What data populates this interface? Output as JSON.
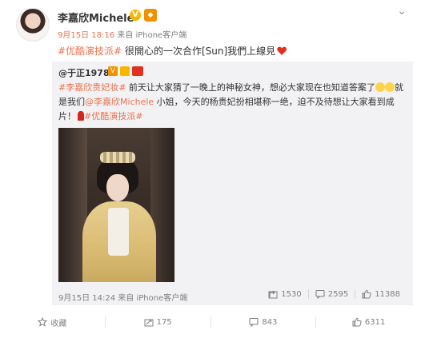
{
  "header": {
    "author": "李嘉欣Michele",
    "v_badge": "V",
    "time": "9月15日 18:16",
    "source": "来自 iPhone客户端"
  },
  "post": {
    "tag": "#优酷演技派#",
    "text": " 很開心的一次合作[Sun]我們上線見"
  },
  "repost": {
    "author": "@于正1978",
    "text": {
      "tag1": "#李嘉欣贵妃妆#",
      "part1": " 前天让大家猜了一晚上的神秘女神，想必大家现在也知道答案了",
      "part2": "就是我们",
      "mention": "@李嘉欣Michele",
      "part3": " 小姐，今天的杨贵妃扮相堪称一绝，迫不及待想让大家看到成片！",
      "tag2": "#优酷演技派#"
    },
    "time": "9月15日 14:24",
    "source": "来自 iPhone客户端",
    "stats": {
      "reposts": "1530",
      "comments": "2595",
      "likes": "11388"
    }
  },
  "actions": {
    "favorite": "收藏",
    "repost": "175",
    "comment": "843",
    "like": "6311"
  },
  "colors": {
    "accent": "#eb7350",
    "repost_bg": "#f2f2f5",
    "heart": "#e0301e"
  }
}
